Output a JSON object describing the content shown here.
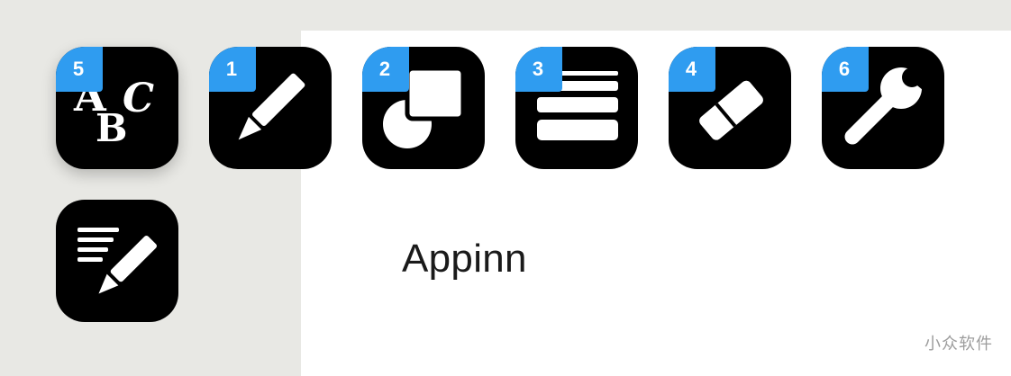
{
  "canvas": {
    "text": "Appinn"
  },
  "watermark": {
    "text": "小众软件"
  },
  "toolbar": {
    "tools": [
      {
        "id": "text",
        "badge": "5",
        "icon": "abc-text-icon",
        "glyph": {
          "a": "A",
          "b": "B",
          "c": "C"
        }
      },
      {
        "id": "pencil",
        "badge": "1",
        "icon": "pencil-icon"
      },
      {
        "id": "shapes",
        "badge": "2",
        "icon": "shapes-icon"
      },
      {
        "id": "lines",
        "badge": "3",
        "icon": "line-weight-icon"
      },
      {
        "id": "eraser",
        "badge": "4",
        "icon": "eraser-icon"
      },
      {
        "id": "settings",
        "badge": "6",
        "icon": "wrench-icon"
      },
      {
        "id": "annotate",
        "icon": "text-pencil-icon"
      }
    ]
  },
  "colors": {
    "badge": "#2f9cf0",
    "tile": "#000000",
    "canvas": "#ffffff",
    "desktop": "#e8e8e4"
  }
}
